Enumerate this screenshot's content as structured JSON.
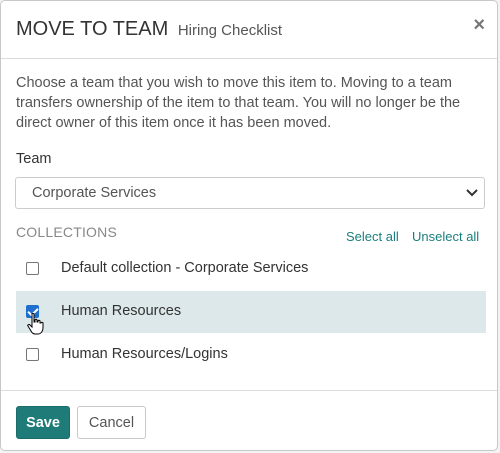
{
  "modal": {
    "title": "MOVE TO TEAM",
    "subtitle": "Hiring Checklist",
    "close_glyph": "×",
    "description": "Choose a team that you wish to move this item to. Moving to a team transfers ownership of the item to that team. You will no longer be the direct owner of this item once it has been moved."
  },
  "team": {
    "label": "Team",
    "selected": "Corporate Services"
  },
  "collections": {
    "label": "COLLECTIONS",
    "select_all": "Select all",
    "unselect_all": "Unselect all",
    "items": [
      {
        "label": "Default collection - Corporate Services",
        "checked": false
      },
      {
        "label": "Human Resources",
        "checked": true
      },
      {
        "label": "Human Resources/Logins",
        "checked": false
      }
    ]
  },
  "footer": {
    "save_label": "Save",
    "cancel_label": "Cancel"
  },
  "colors": {
    "accent": "#1e7b78",
    "link": "#1a7f7c",
    "row_highlight": "#dde8ea",
    "checkbox_checked": "#1f6fcf"
  },
  "icons": {
    "close": "close-icon",
    "dropdown": "chevron-down-icon",
    "pointer": "hand-pointer-icon"
  }
}
